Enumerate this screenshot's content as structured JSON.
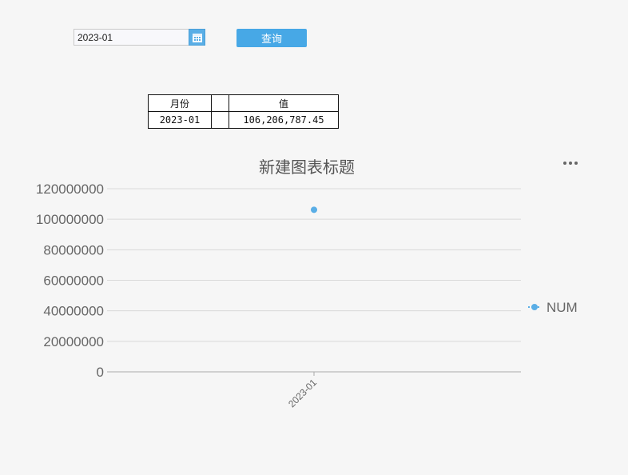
{
  "filter": {
    "date_value": "2023-01",
    "query_label": "查询"
  },
  "table": {
    "headers": [
      "月份",
      "",
      "值"
    ],
    "rows": [
      [
        "2023-01",
        "",
        "106,206,787.45"
      ]
    ]
  },
  "chart_data": {
    "type": "scatter",
    "title": "新建图表标题",
    "categories": [
      "2023-01"
    ],
    "series": [
      {
        "name": "NUM",
        "values": [
          106206787.45
        ]
      }
    ],
    "y_ticks": [
      "0",
      "20000000",
      "40000000",
      "60000000",
      "80000000",
      "100000000",
      "120000000"
    ],
    "ylim": [
      0,
      120000000
    ],
    "grid": true,
    "legend_position": "right",
    "x_label_rotation": "-45deg"
  },
  "colors": {
    "accent": "#47a8e6",
    "series": "#5aaee6",
    "grid": "#d9d9d9",
    "axis": "#aaaaaa",
    "text": "#666666"
  },
  "icons": {
    "calendar": "calendar-icon",
    "more": "more-icon"
  }
}
